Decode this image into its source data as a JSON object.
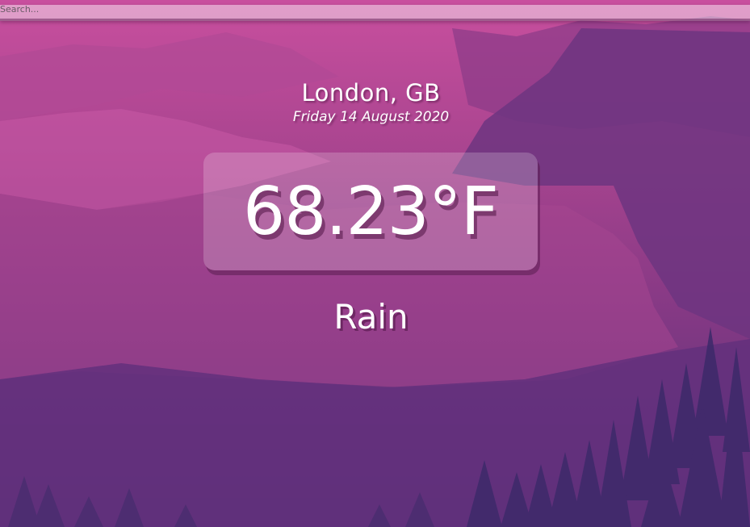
{
  "search": {
    "placeholder": "Search...",
    "value": ""
  },
  "location": {
    "city": "London, GB",
    "date": "Friday 14 August 2020"
  },
  "weather": {
    "temperature": "68.23°F",
    "condition": "Rain"
  },
  "colors": {
    "sky_top": "#c84f9e",
    "sky_bottom": "#4e2d72",
    "trees": "#3f2a6b",
    "text": "#ffffff"
  }
}
